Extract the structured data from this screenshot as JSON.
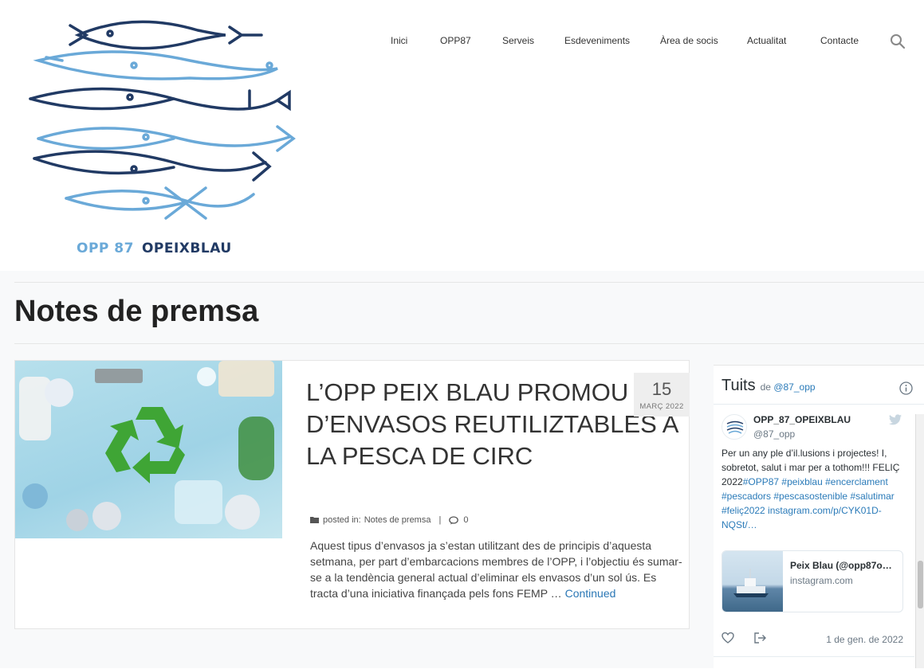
{
  "header": {
    "logo_opp": "OPP 87",
    "logo_brand": "OPEIXBLAU",
    "nav": [
      "Inici",
      "OPP87",
      "Serveis",
      "Esdeveniments",
      "Àrea de socis",
      "Actualitat",
      "Contacte"
    ]
  },
  "page": {
    "title": "Notes de premsa"
  },
  "post": {
    "title": "L’OPP PEIX BLAU PROMOU L’ÚS D’ENVASOS REUTILIZTABLES A LA PESCA DE CIRC",
    "date_day": "15",
    "date_month": "MARÇ 2022",
    "posted_in_label": "posted in:",
    "category": "Notes de premsa",
    "separator": "|",
    "comments": "0",
    "excerpt": "Aquest tipus d’envasos ja s’estan utilitzant des de principis d’aquesta setmana, per part d’embarcacions membres de l’OPP, i l’objectiu és sumar-se a la tendència general actual d’eliminar els envasos d’un sol ús. Es tracta d’una iniciativa finançada pels fons FEMP … ",
    "continue_label": "Continued"
  },
  "twitter": {
    "title": "Tuits",
    "by_label": "de",
    "by_handle": "@87_opp",
    "tweet": {
      "name": "OPP_87_OPEIXBLAU",
      "handle": "@87_opp",
      "text_plain": "Per un any ple d’il.lusions i projectes! I, sobretot, salut i mar per a tothom!!! FELIÇ 2022",
      "text_links": "#OPP87 #peixblau #encerclament #pescadors #pescasostenible #salutimar #feliç2022 instagram.com/p/CYK01D-NQSt/…",
      "card_title": "Peix Blau (@opp87o…",
      "card_sub": "instagram.com",
      "date": "1 de gen. de 2022"
    }
  },
  "colors": {
    "dark_blue": "#213a64",
    "light_blue": "#6aa9d8",
    "link": "#2b7bb9"
  }
}
